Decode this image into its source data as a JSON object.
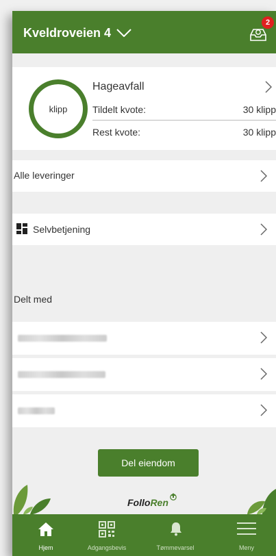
{
  "header": {
    "title": "Kveldroveien 4",
    "badge_count": "2"
  },
  "quota": {
    "ring_label": "klipp",
    "title": "Hageavfall",
    "allotted_label": "Tildelt kvote:",
    "allotted_value": "30 klipp",
    "remaining_label": "Rest kvote:",
    "remaining_value": "30 klipp"
  },
  "deliveries": {
    "label": "Alle leveringer"
  },
  "selfservice": {
    "label": "Selvbetjening"
  },
  "shared": {
    "heading": "Delt med"
  },
  "share_button": {
    "label": "Del eiendom"
  },
  "logo": {
    "part1": "Follo",
    "part2": "Ren"
  },
  "nav": [
    {
      "label": "Hjem",
      "icon": "home-icon",
      "active": true
    },
    {
      "label": "Adgangsbevis",
      "icon": "qr-code-icon",
      "active": false
    },
    {
      "label": "Tømmevarsel",
      "icon": "bell-icon",
      "active": false
    },
    {
      "label": "Meny",
      "icon": "menu-icon",
      "active": false
    }
  ],
  "colors": {
    "brand_green": "#4a7f2c",
    "badge_red": "#e02020",
    "background": "#efefef"
  }
}
